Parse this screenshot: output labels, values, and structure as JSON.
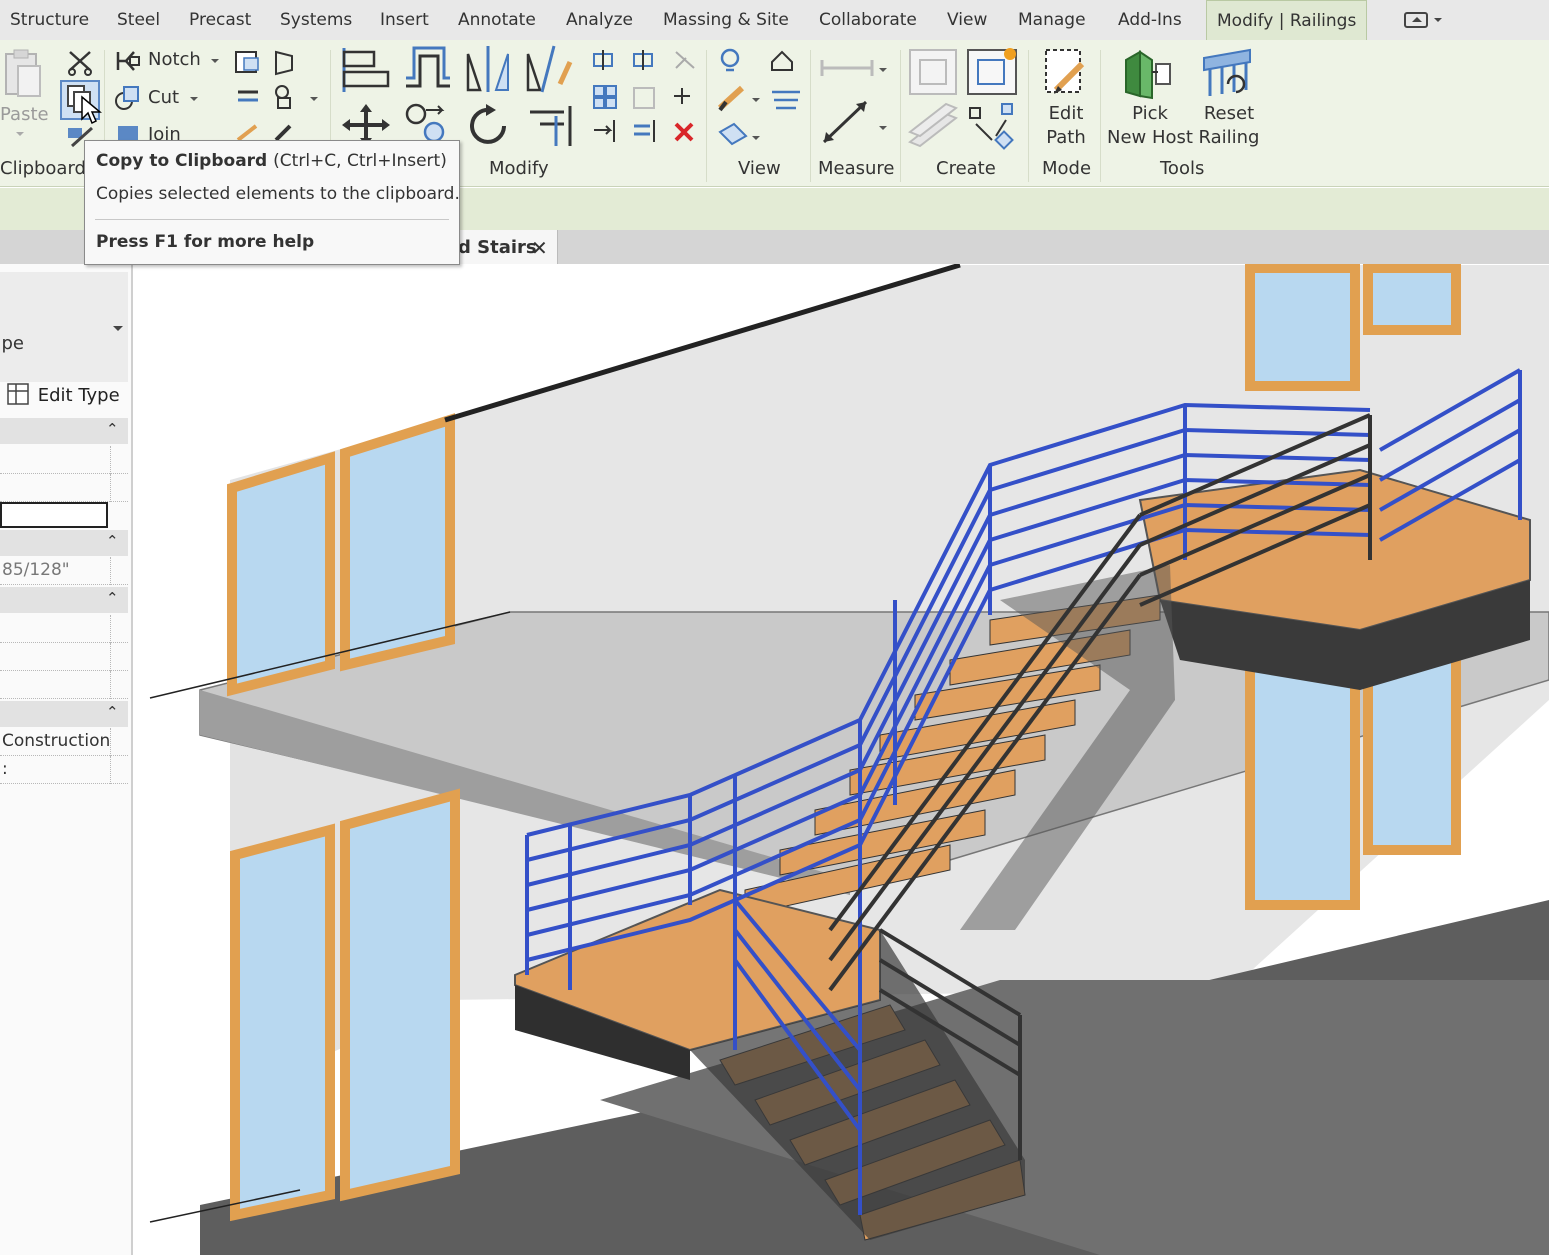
{
  "menu": {
    "tabs": [
      "Structure",
      "Steel",
      "Precast",
      "Systems",
      "Insert",
      "Annotate",
      "Analyze",
      "Massing & Site",
      "Collaborate",
      "View",
      "Manage",
      "Add-Ins",
      "Modify | Railings"
    ],
    "active_tab": "Modify | Railings"
  },
  "ribbon": {
    "clipboard": {
      "paste_label": "Paste",
      "panel_label": "Clipboard"
    },
    "geometry": {
      "notch_label": "Notch",
      "cut_label": "Cut",
      "join_label": "Join"
    },
    "modify": {
      "panel_label": "Modify"
    },
    "view": {
      "panel_label": "View"
    },
    "measure": {
      "panel_label": "Measure"
    },
    "create": {
      "panel_label": "Create"
    },
    "mode": {
      "edit_path_label": "Edit\nPath",
      "panel_label": "Mode"
    },
    "tools": {
      "pick_host_label": "Pick\nNew Host",
      "reset_railing_label": "Reset\nRailing",
      "panel_label": "Tools"
    }
  },
  "tooltip": {
    "title": "Copy to Clipboard",
    "shortcut": "(Ctrl+C, Ctrl+Insert)",
    "description": "Copies selected elements to the clipboard.",
    "help": "Press F1 for more help"
  },
  "view_tab": {
    "label": "d Stairs",
    "close_glyph": "✕"
  },
  "properties": {
    "type_name": "Pipe",
    "edit_type_label": "Edit Type",
    "length_value": "85/128\"",
    "phase_value": "Construction",
    "last_value": ":"
  },
  "colors": {
    "ribbon_bg": "#eef3e6",
    "selected_railing": "#3450c8",
    "stair_tread": "#e0a060",
    "stringer": "#3a3a3a",
    "window_glass": "#b8d8f0",
    "window_frame": "#e1a050"
  },
  "icons": [
    "cut-scissors-icon",
    "copy-icon",
    "match-properties-icon",
    "notch-icon",
    "cut-geometry-icon",
    "join-icon",
    "align-icon",
    "offset-icon",
    "mirror-icon",
    "move-icon",
    "copy-tool-icon",
    "rotate-icon",
    "trim-icon",
    "array-icon",
    "scale-icon",
    "pin-icon",
    "delete-icon",
    "hide-icon",
    "override-icon",
    "measure-icon",
    "create-group-icon",
    "create-assembly-icon",
    "edit-path-icon",
    "pick-host-icon",
    "reset-railing-icon",
    "cursor-arrow-icon"
  ]
}
